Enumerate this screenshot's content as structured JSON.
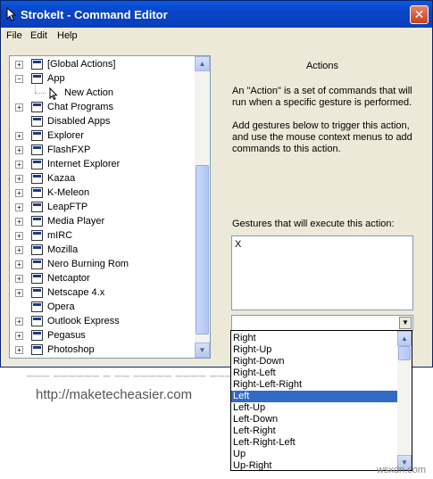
{
  "window": {
    "title": "StrokeIt - Command Editor",
    "close_label": "✕"
  },
  "menu": [
    "File",
    "Edit",
    "Help"
  ],
  "tree": [
    {
      "label": "[Global Actions]",
      "expander": "+",
      "level": 0
    },
    {
      "label": "App",
      "expander": "−",
      "level": 0
    },
    {
      "label": "New Action",
      "expander": "",
      "level": 1
    },
    {
      "label": "Chat Programs",
      "expander": "+",
      "level": 0
    },
    {
      "label": "Disabled Apps",
      "expander": "",
      "level": 0
    },
    {
      "label": "Explorer",
      "expander": "+",
      "level": 0
    },
    {
      "label": "FlashFXP",
      "expander": "+",
      "level": 0
    },
    {
      "label": "Internet Explorer",
      "expander": "+",
      "level": 0
    },
    {
      "label": "Kazaa",
      "expander": "+",
      "level": 0
    },
    {
      "label": "K-Meleon",
      "expander": "+",
      "level": 0
    },
    {
      "label": "LeapFTP",
      "expander": "+",
      "level": 0
    },
    {
      "label": "Media Player",
      "expander": "+",
      "level": 0
    },
    {
      "label": "mIRC",
      "expander": "+",
      "level": 0
    },
    {
      "label": "Mozilla",
      "expander": "+",
      "level": 0
    },
    {
      "label": "Nero Burning Rom",
      "expander": "+",
      "level": 0
    },
    {
      "label": "Netcaptor",
      "expander": "+",
      "level": 0
    },
    {
      "label": "Netscape 4.x",
      "expander": "+",
      "level": 0
    },
    {
      "label": "Opera",
      "expander": "",
      "level": 0
    },
    {
      "label": "Outlook Express",
      "expander": "+",
      "level": 0
    },
    {
      "label": "Pegasus",
      "expander": "+",
      "level": 0
    },
    {
      "label": "Photoshop",
      "expander": "+",
      "level": 0
    }
  ],
  "panel": {
    "title": "Actions",
    "desc1": "An \"Action\" is a set of commands that will run when a specific gesture is performed.",
    "desc2": "Add gestures below to trigger this action, and use the mouse context menus to add commands to this action.",
    "gestures_label": "Gestures that will execute this action:",
    "gesture_value": "X"
  },
  "dropdown": {
    "options": [
      "Right",
      "Right-Up",
      "Right-Down",
      "Right-Left",
      "Right-Left-Right",
      "Left",
      "Left-Up",
      "Left-Down",
      "Left-Right",
      "Left-Right-Left",
      "Up",
      "Up-Right"
    ],
    "selected_index": 5
  },
  "url": "http://maketecheasier.com",
  "watermark": "wsxdn.com"
}
